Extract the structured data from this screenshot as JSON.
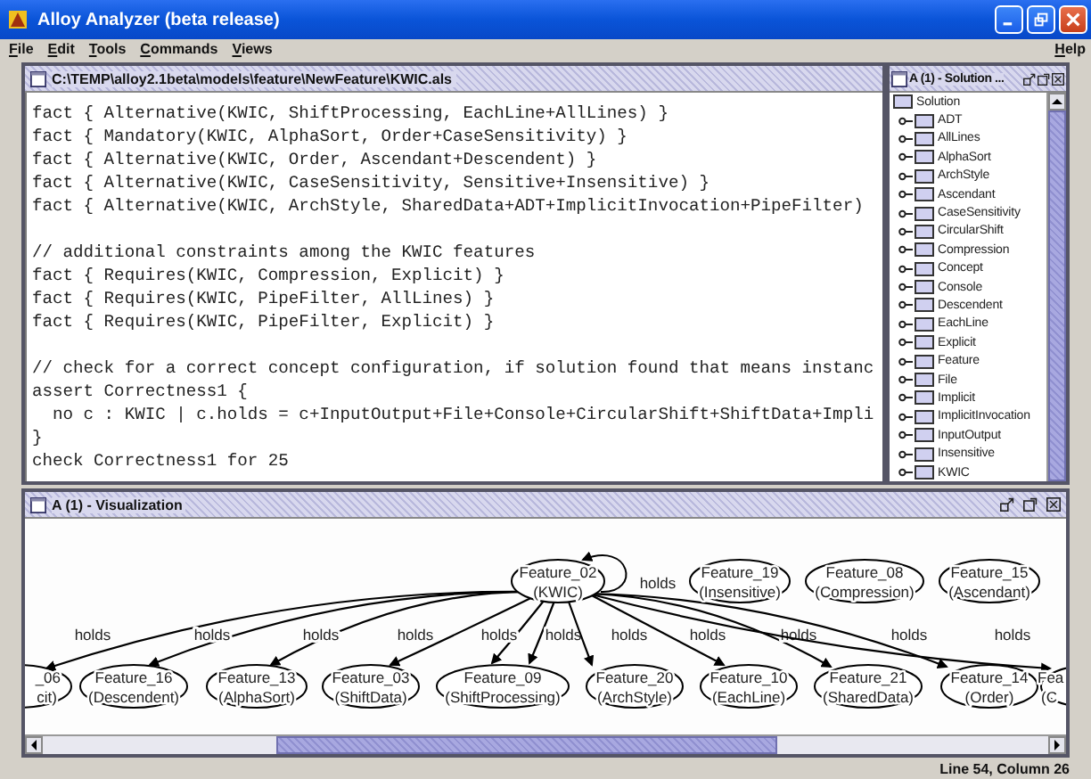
{
  "window": {
    "title": "Alloy Analyzer (beta release)"
  },
  "menus": [
    "File",
    "Edit",
    "Tools",
    "Commands",
    "Views"
  ],
  "help_menu": "Help",
  "editor": {
    "title": "C:\\TEMP\\alloy2.1beta\\models\\feature\\NewFeature\\KWIC.als",
    "code_blocks": [
      [
        "fact { Alternative(KWIC, ShiftProcessing, EachLine+AllLines) }",
        "fact { Mandatory(KWIC, AlphaSort, Order+CaseSensitivity) }",
        "fact { Alternative(KWIC, Order, Ascendant+Descendent) }",
        "fact { Alternative(KWIC, CaseSensitivity, Sensitive+Insensitive) }",
        "fact { Alternative(KWIC, ArchStyle, SharedData+ADT+ImplicitInvocation+PipeFilter)"
      ],
      [
        "// additional constraints among the KWIC features",
        "fact { Requires(KWIC, Compression, Explicit) }",
        "fact { Requires(KWIC, PipeFilter, AllLines) }",
        "fact { Requires(KWIC, PipeFilter, Explicit) }"
      ],
      [
        "// check for a correct concept configuration, if solution found that means instanc",
        "assert Correctness1 {",
        "  no c : KWIC | c.holds = c+InputOutput+File+Console+CircularShift+ShiftData+Impli",
        "}",
        "check Correctness1 for 25"
      ]
    ]
  },
  "solution": {
    "title": "A (1) - Solution ...",
    "root": "Solution",
    "items": [
      "ADT",
      "AllLines",
      "AlphaSort",
      "ArchStyle",
      "Ascendant",
      "CaseSensitivity",
      "CircularShift",
      "Compression",
      "Concept",
      "Console",
      "Descendent",
      "EachLine",
      "Explicit",
      "Feature",
      "File",
      "Implicit",
      "ImplicitInvocation",
      "InputOutput",
      "Insensitive",
      "KWIC"
    ]
  },
  "visualization": {
    "title": "A (1) - Visualization",
    "nodes": [
      {
        "line_1": "Feature_02",
        "line_2": "(KWIC)"
      },
      {
        "line_1": "Feature_19",
        "line_2": "(Insensitive)"
      },
      {
        "line_1": "Feature_08",
        "line_2": "(Compression)"
      },
      {
        "line_1": "Feature_15",
        "line_2": "(Ascendant)"
      },
      {
        "line_1": "_06",
        "line_2": "cit)"
      },
      {
        "line_1": "Feature_16",
        "line_2": "(Descendent)"
      },
      {
        "line_1": "Feature_13",
        "line_2": "(AlphaSort)"
      },
      {
        "line_1": "Feature_03",
        "line_2": "(ShiftData)"
      },
      {
        "line_1": "Feature_09",
        "line_2": "(ShiftProcessing)"
      },
      {
        "line_1": "Feature_20",
        "line_2": "(ArchStyle)"
      },
      {
        "line_1": "Feature_10",
        "line_2": "(EachLine)"
      },
      {
        "line_1": "Feature_21",
        "line_2": "(SharedData)"
      },
      {
        "line_1": "Feature_14",
        "line_2": "(Order)"
      },
      {
        "line_1": "Fea",
        "line_2": "(C"
      }
    ],
    "edges": [
      {
        "kind": "loop",
        "label": "holds"
      },
      {
        "kind": "down",
        "label": "holds"
      },
      {
        "kind": "down",
        "label": "holds"
      },
      {
        "kind": "down",
        "label": "holds"
      },
      {
        "kind": "down",
        "label": "holds"
      },
      {
        "kind": "down",
        "label": "holds"
      },
      {
        "kind": "down",
        "label": "holds"
      },
      {
        "kind": "down",
        "label": "holds"
      },
      {
        "kind": "down",
        "label": "holds"
      },
      {
        "kind": "down",
        "label": "holds"
      },
      {
        "kind": "down",
        "label": "holds"
      },
      {
        "kind": "down",
        "label": "holds"
      }
    ]
  },
  "status_bar": "Line 54, Column 26"
}
